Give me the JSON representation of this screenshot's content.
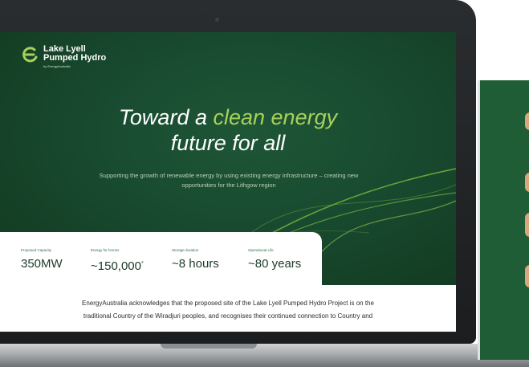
{
  "logo": {
    "line1": "Lake Lyell",
    "line2": "Pumped Hydro",
    "byline": "by EnergyAustralia"
  },
  "hero": {
    "headline_pre": "Toward a ",
    "headline_accent": "clean energy",
    "headline_line2": "future for all",
    "subtext": "Supporting the growth of renewable energy by using existing energy infrastructure – creating new opportunities for the Lithgow region"
  },
  "stats": [
    {
      "label": "Proposed Capacity",
      "value": "350MW"
    },
    {
      "label": "Energy for homes",
      "value": "~150,000",
      "footnote": "*"
    },
    {
      "label": "Storage duration",
      "value": "~8 hours"
    },
    {
      "label": "Operational Life",
      "value": "~80 years"
    }
  ],
  "acknowledgement": {
    "line1": "EnergyAustralia acknowledges that the proposed site of the Lake Lyell Pumped Hydro Project is on the",
    "line2": "traditional Country of the Wiradjuri peoples, and recognises their continued connection to Country and"
  },
  "colors": {
    "hero_green": "#184a2f",
    "accent_green": "#a8d05a",
    "tablet_green": "#1e5d35"
  },
  "icons": {
    "logo": "energy-swirl-logo-icon"
  }
}
